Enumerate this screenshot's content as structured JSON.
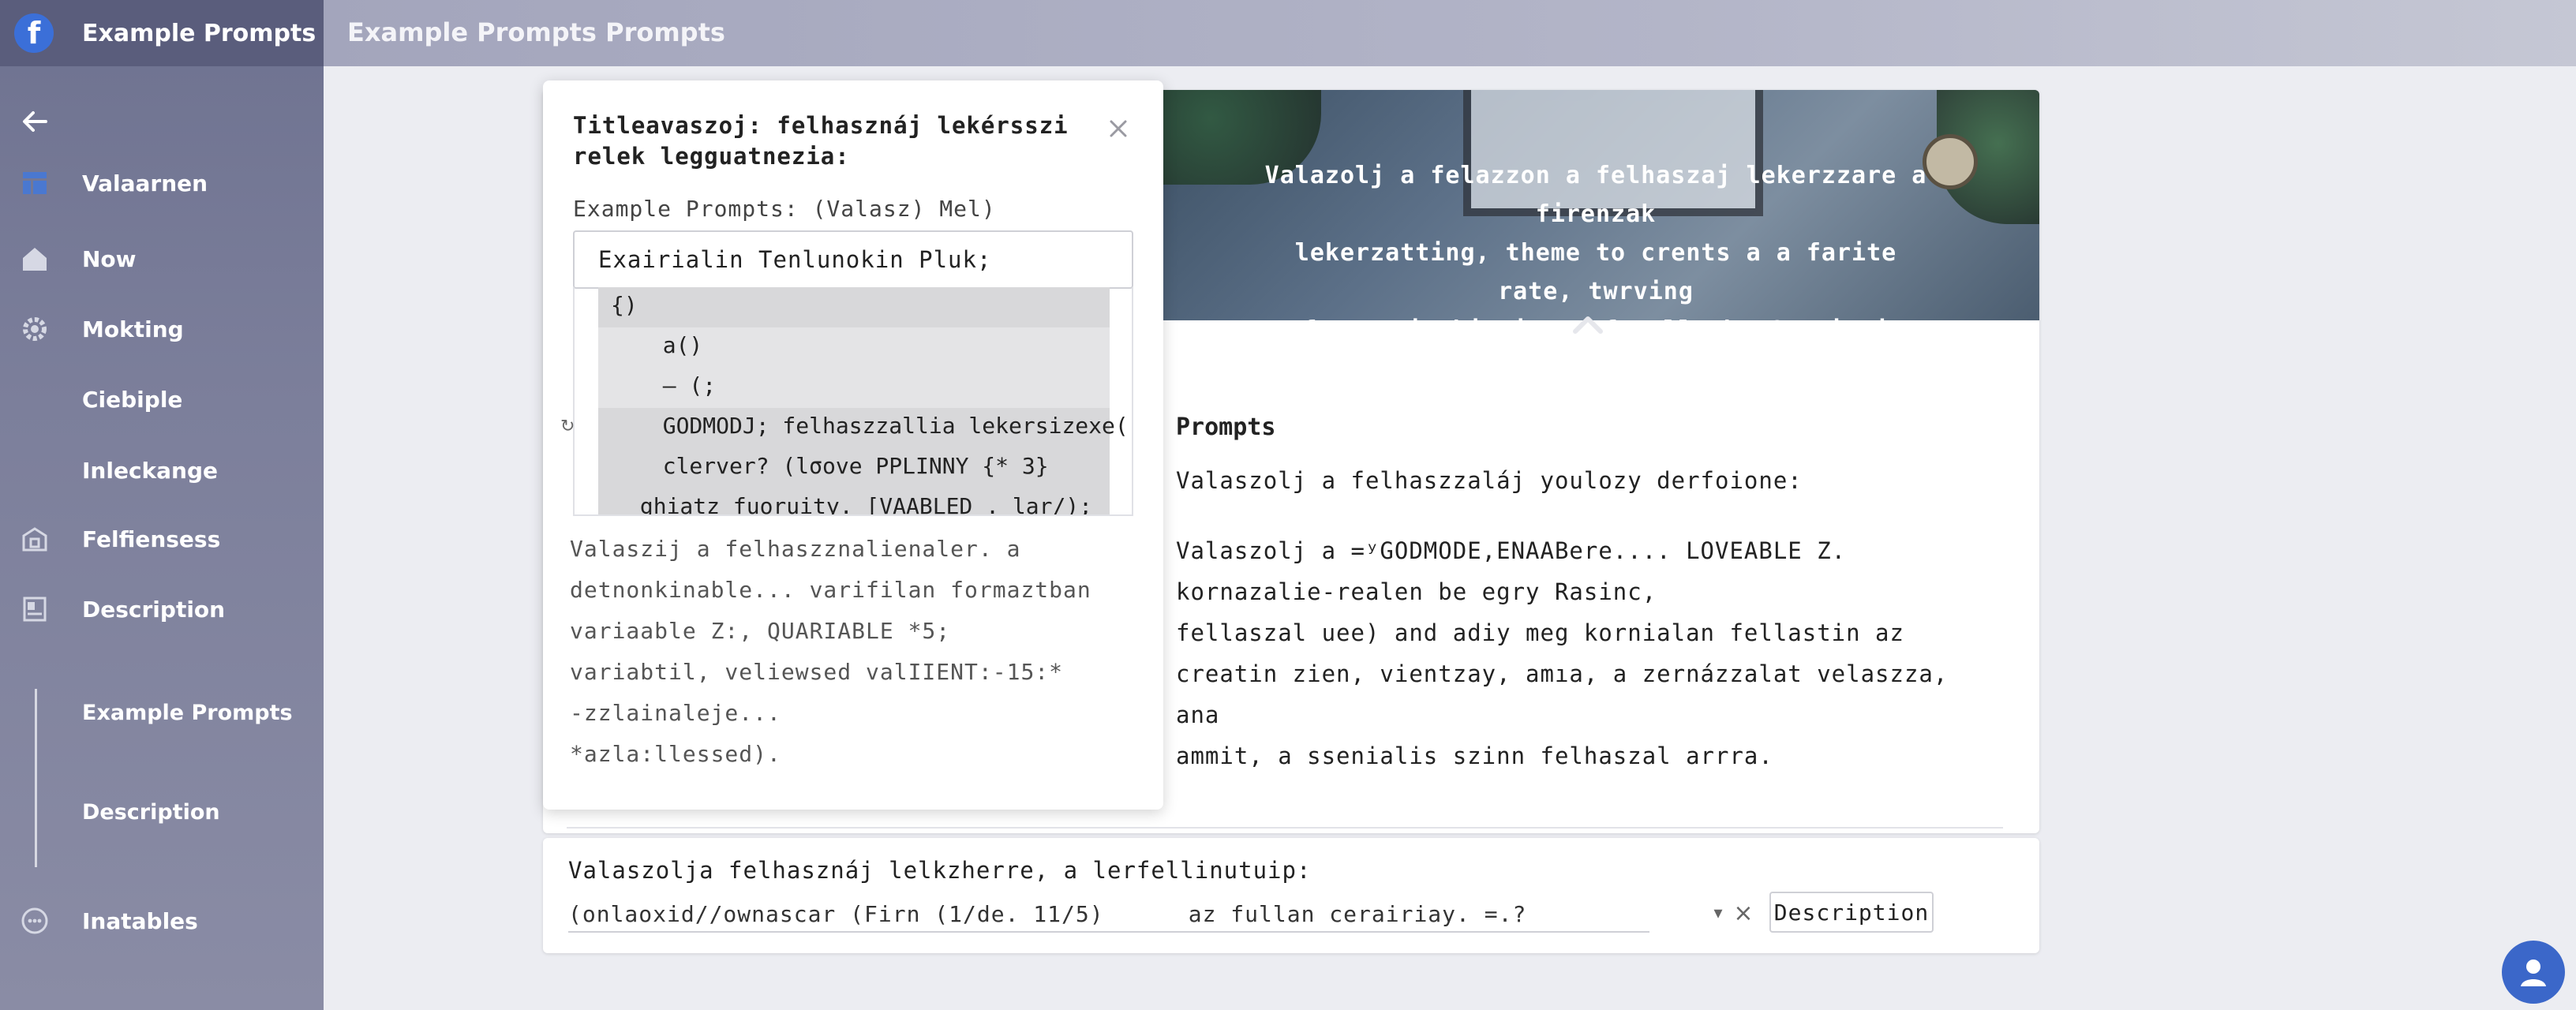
{
  "app": {
    "name": "Example Prompts",
    "page_title": "Example Prompts Prompts"
  },
  "sidebar": {
    "items": [
      {
        "label": "Valaarnen",
        "icon": "layout-icon"
      },
      {
        "label": "Now",
        "icon": "home-icon"
      },
      {
        "label": "Mokting",
        "icon": "gear-icon"
      },
      {
        "label": "Ciebiple",
        "icon": ""
      },
      {
        "label": "Inleckange",
        "icon": ""
      },
      {
        "label": "Felfiensess",
        "icon": "bank-icon"
      },
      {
        "label": "Description",
        "icon": "document-icon"
      }
    ],
    "sub_items": [
      {
        "label": "Example Prompts"
      },
      {
        "label": "Description"
      }
    ],
    "footer_item": {
      "label": "Inatables",
      "icon": "chat-icon"
    }
  },
  "hero": {
    "text_lines": [
      "Valazolj a felazzon a felhaszaj lekerzzare a firenzak",
      "lekerzatting, theme to crents a a farite rate, twrving",
      "exfecter in biezinne of Dully be Gurtin jas ar Ecrie."
    ]
  },
  "main": {
    "title": "Prompts",
    "subtitle": "Valaszolj a felhaszzaláj youlozy derfoione:",
    "body_lines": [
      "Valaszolj a =ʸGODMODE,ENAABere.... LOVEABLE Z.",
      "kornazalie-realen be egry Rasinc,",
      "fellaszal uee) and adiy meg kornialan fellastin az",
      "creatin zien, vientzay, amıa, a zernázzalat velaszza, ana",
      "ammit, a ssenialis szinn felhaszal arrra."
    ]
  },
  "modal": {
    "title": "Titleavaszoj: felhasznáj lekérsszi relek legguatnezia:",
    "field_label": "Example Prompts: (Valasz) Mel)",
    "input_value": "Exairialin Tenlunokin Pluk;",
    "code_lines": [
      "{)",
      "  a()",
      "  — (;",
      "  GODMODJ; felhaszzallia lekersizexe()",
      "  clerver? (lσove PPLINNY {* 3}",
      " ghiatz fuoruity. [VAABLED . lar/);"
    ],
    "body_lines": [
      "Valaszij a felhaszznalienaler. a",
      "detnonkinable... varifilan formaztban",
      "variaable Z:, QUARIABLE *5;",
      "variabtil, veliewsed valIIENT:-15:*",
      "-zzlainaleje...",
      "*azla:llessed)."
    ]
  },
  "bottom": {
    "label": "Valaszolja felhasznáj lelkzherre, a lerfellinutuip:",
    "input_value": "(onlaoxid//ownascar (Firn (1/de. 11/5)      az fullan cerairiay. =.?",
    "button_label": "Description"
  },
  "colors": {
    "sidebar": "#7a7d99",
    "topbar": "#b0b2c6",
    "accent": "#3b6fd8"
  }
}
